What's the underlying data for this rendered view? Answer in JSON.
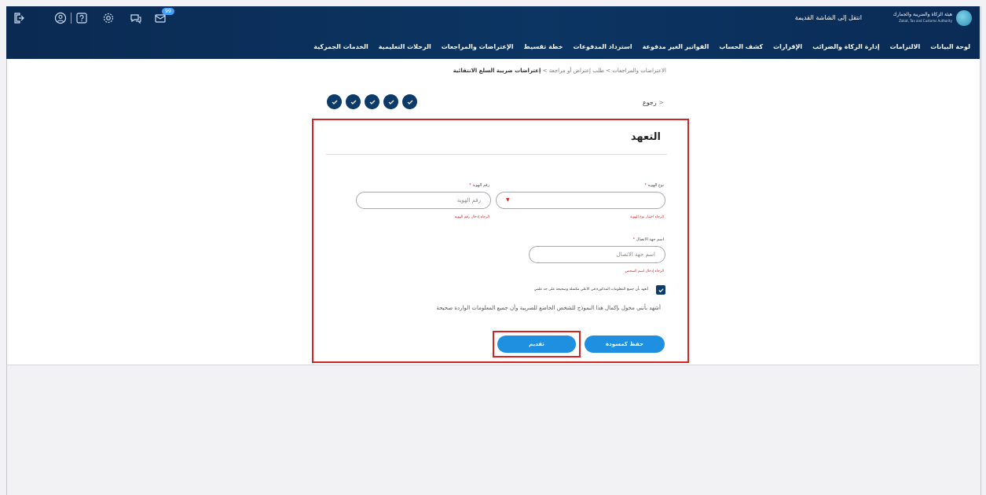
{
  "header": {
    "logo_ar": "هيئة الزكاة والضريبة والجمارك",
    "logo_en": "Zakat, Tax and Customs Authority",
    "old_screen_link": "انتقل إلى الشاشة القديمة",
    "notification_count": "99",
    "icons": [
      "logout-icon",
      "user-icon",
      "help-icon",
      "settings-icon",
      "chat-icon",
      "mail-icon"
    ]
  },
  "nav": {
    "items": [
      "لوحة البيانات",
      "الالتزامات",
      "إدارة الزكاة والضرائب",
      "الإقرارات",
      "كشف الحساب",
      "الفواتير الغير مدفوعة",
      "استرداد المدفوعات",
      "خطة تقسيط",
      "الإعتراضات والمراجعات",
      "الرحلات التعليمية",
      "الخدمات الجمركية"
    ]
  },
  "breadcrumb": {
    "part1": "الاعتراضات والمراجعات",
    "part2": "طلب إعتراض أو مراجعة",
    "current": "إعتراضات ضريبة السلع الانتقائية",
    "separator": ">"
  },
  "back_label": "رجوع",
  "form": {
    "title": "التعهد",
    "id_type_label": "نوع الهوية",
    "id_type_error": "الرجاء اختيار نوع الهوية",
    "id_number_label": "رقم الهوية",
    "id_number_placeholder": "رقم الهوية",
    "id_number_error": "الرجاء إدخال رقم الهوية",
    "contact_label": "اسم جهة الاتصال",
    "contact_placeholder": "اسم جهة الاتصال",
    "contact_error": "الرجاء إدخال اسم الشخص",
    "checkbox_text": "أتعهد بأن جميع المعلومات المذكورة في الأعلى مكتملة وصحيحة على حد علمي",
    "declaration": "أشهد بأنني مخول بإكمال هذا النموذج للشخص الخاضع للضريبة وأن جميع المعلومات الواردة صحيحة",
    "submit_label": "تقديم",
    "save_draft_label": "حفظ كمسودة",
    "required_mark": "*"
  },
  "colors": {
    "header_bg": "#0c3563",
    "accent": "#1f8fe0",
    "highlight": "#d32424",
    "step": "#0c3a69"
  }
}
